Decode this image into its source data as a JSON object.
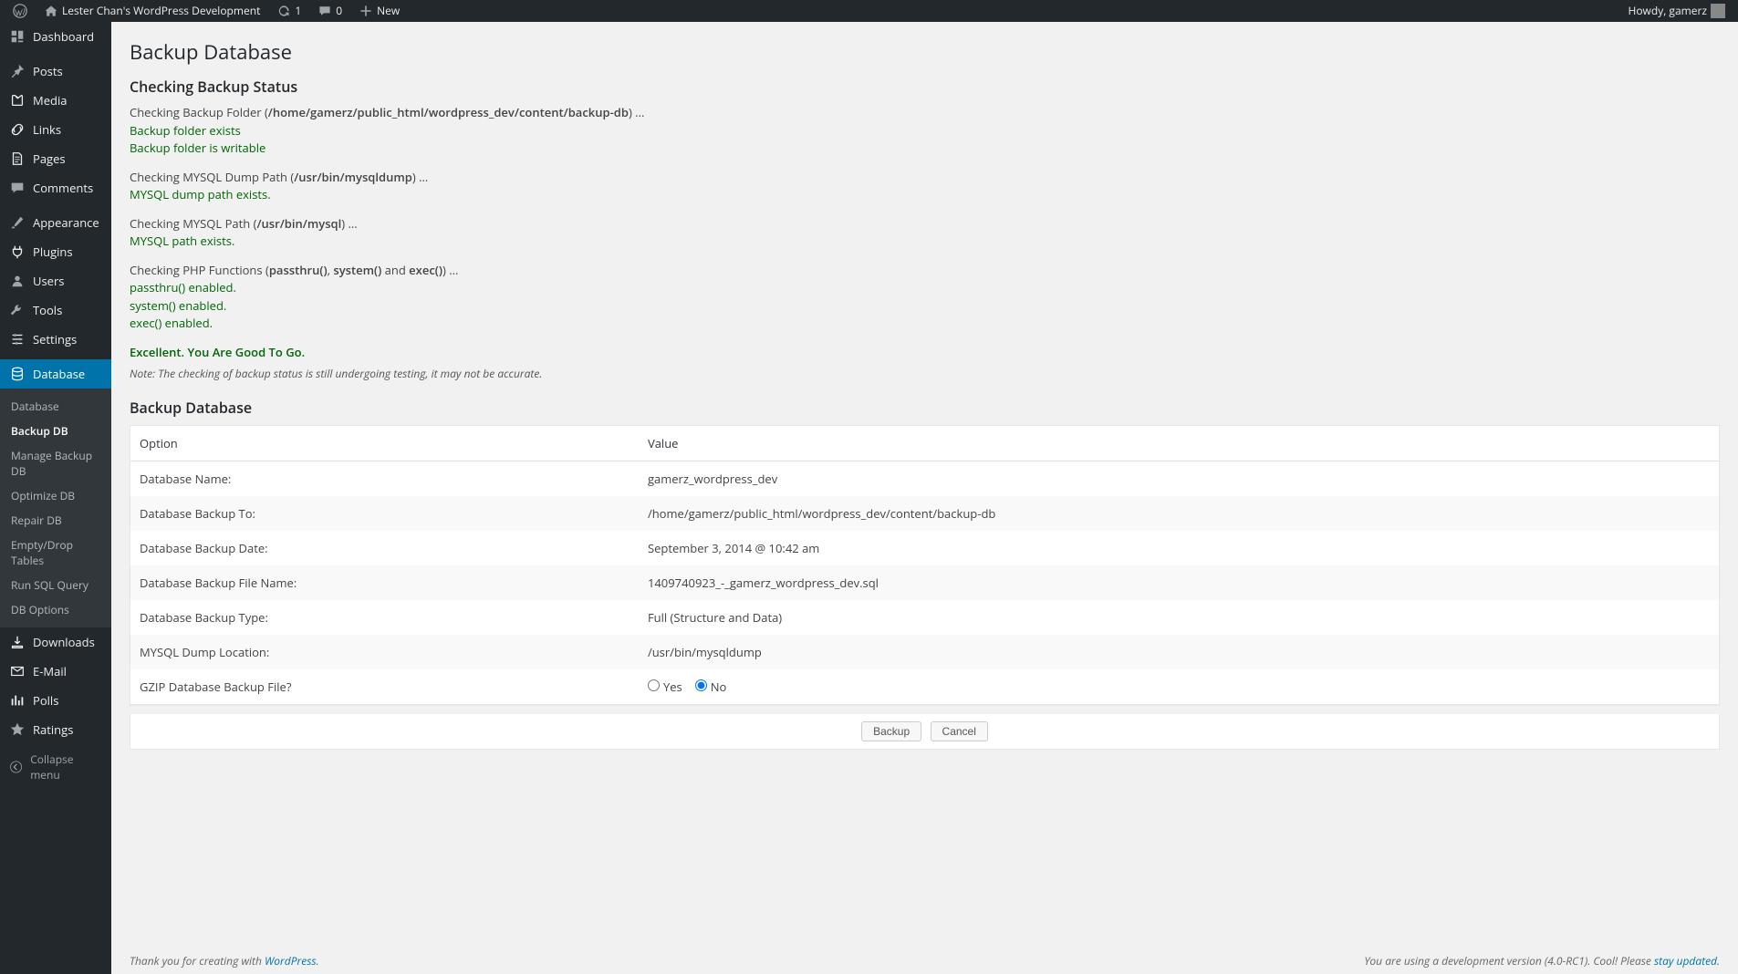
{
  "adminbar": {
    "site_name": "Lester Chan's WordPress Development",
    "updates_count": "1",
    "comments_count": "0",
    "new_label": "New",
    "howdy": "Howdy, gamerz"
  },
  "sidebar": {
    "items": [
      {
        "icon": "dashboard",
        "label": "Dashboard"
      },
      {
        "icon": "pin",
        "label": "Posts",
        "sep": true
      },
      {
        "icon": "media",
        "label": "Media"
      },
      {
        "icon": "link",
        "label": "Links"
      },
      {
        "icon": "page",
        "label": "Pages"
      },
      {
        "icon": "comment",
        "label": "Comments"
      },
      {
        "icon": "brush",
        "label": "Appearance",
        "sep": true
      },
      {
        "icon": "plug",
        "label": "Plugins"
      },
      {
        "icon": "user",
        "label": "Users"
      },
      {
        "icon": "wrench",
        "label": "Tools"
      },
      {
        "icon": "sliders",
        "label": "Settings"
      },
      {
        "icon": "database",
        "label": "Database",
        "current": true,
        "sep": true
      },
      {
        "icon": "download",
        "label": "Downloads"
      },
      {
        "icon": "mail",
        "label": "E-Mail"
      },
      {
        "icon": "poll",
        "label": "Polls"
      },
      {
        "icon": "star",
        "label": "Ratings"
      }
    ],
    "submenu": [
      {
        "label": "Database"
      },
      {
        "label": "Backup DB",
        "current": true
      },
      {
        "label": "Manage Backup DB"
      },
      {
        "label": "Optimize DB"
      },
      {
        "label": "Repair DB"
      },
      {
        "label": "Empty/Drop Tables"
      },
      {
        "label": "Run SQL Query"
      },
      {
        "label": "DB Options"
      }
    ],
    "collapse_label": "Collapse menu"
  },
  "page": {
    "title": "Backup Database",
    "checking_heading": "Checking Backup Status",
    "backup_heading": "Backup Database",
    "excellent": "Excellent. You Are Good To Go.",
    "note": "Note: The checking of backup status is still undergoing testing, it may not be accurate."
  },
  "status": {
    "folder": {
      "prefix": "Checking Backup Folder (",
      "path": "/home/gamerz/public_html/wordpress_dev/content/backup-db",
      "suffix": ") ...",
      "ok1": "Backup folder exists",
      "ok2": "Backup folder is writable"
    },
    "mysqldump": {
      "prefix": "Checking MYSQL Dump Path (",
      "path": "/usr/bin/mysqldump",
      "suffix": ") ...",
      "ok1": "MYSQL dump path exists."
    },
    "mysql": {
      "prefix": "Checking MYSQL Path (",
      "path": "/usr/bin/mysql",
      "suffix": ") ...",
      "ok1": "MYSQL path exists."
    },
    "php": {
      "prefix": "Checking PHP Functions (",
      "f1": "passthru()",
      "mid1": ", ",
      "f2": "system()",
      "mid2": " and ",
      "f3": "exec()",
      "suffix": ") ...",
      "ok1": "passthru() enabled.",
      "ok2": "system() enabled.",
      "ok3": "exec() enabled."
    }
  },
  "table": {
    "col_option": "Option",
    "col_value": "Value",
    "rows": [
      {
        "option": "Database Name:",
        "value": "gamerz_wordpress_dev"
      },
      {
        "option": "Database Backup To:",
        "value": "/home/gamerz/public_html/wordpress_dev/content/backup-db"
      },
      {
        "option": "Database Backup Date:",
        "value": "September 3, 2014 @ 10:42 am"
      },
      {
        "option": "Database Backup File Name:",
        "value": "1409740923_-_gamerz_wordpress_dev.sql"
      },
      {
        "option": "Database Backup Type:",
        "value": "Full (Structure and Data)"
      },
      {
        "option": "MYSQL Dump Location:",
        "value": "/usr/bin/mysqldump"
      }
    ],
    "gzip_option": "GZIP Database Backup File?",
    "gzip_yes": "Yes",
    "gzip_no": "No",
    "backup_btn": "Backup",
    "cancel_btn": "Cancel"
  },
  "footer": {
    "thanks_prefix": "Thank you for creating with ",
    "thanks_link": "WordPress",
    "thanks_suffix": ".",
    "version_prefix": "You are using a development version (4.0-RC1). Cool! Please ",
    "version_link": "stay updated",
    "version_suffix": "."
  }
}
